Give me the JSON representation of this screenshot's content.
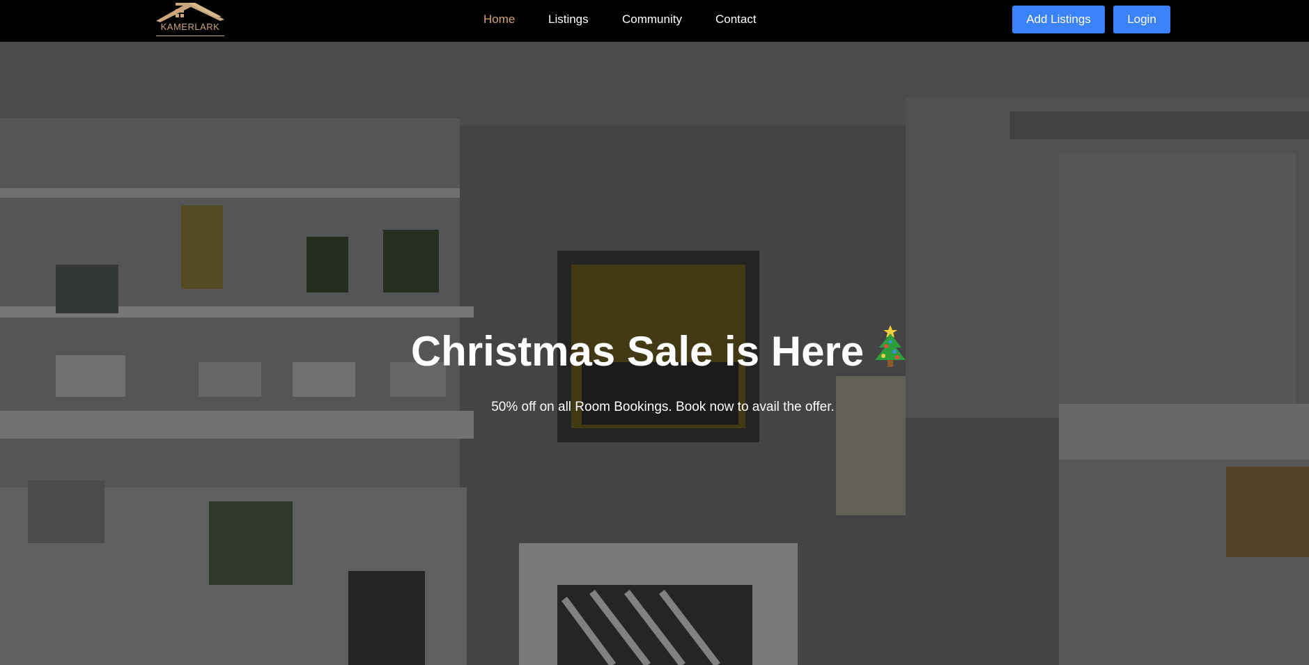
{
  "brand": {
    "name": "KAMERLARK",
    "logo_icon": "house-roof-icon",
    "accent_color": "#c9a77c"
  },
  "nav": {
    "items": [
      {
        "label": "Home",
        "active": true
      },
      {
        "label": "Listings",
        "active": false
      },
      {
        "label": "Community",
        "active": false
      },
      {
        "label": "Contact",
        "active": false
      }
    ],
    "active_color": "#d4a373"
  },
  "actions": {
    "add_listings_label": "Add Listings",
    "login_label": "Login",
    "button_color": "#3b82f6"
  },
  "hero": {
    "title": "Christmas Sale is Here",
    "title_icon": "christmas-tree-icon",
    "subtitle": "50% off on all Room Bookings. Book now to avail the offer."
  }
}
